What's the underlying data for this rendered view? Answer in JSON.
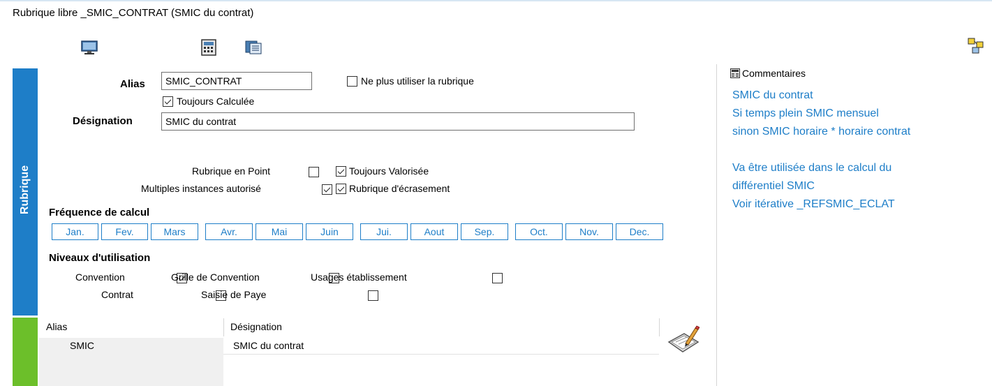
{
  "window": {
    "title": "Rubrique libre _SMIC_CONTRAT (SMIC du contrat)"
  },
  "toolbar": {
    "icons": [
      "monitor-icon",
      "calculator-icon",
      "window-list-icon",
      "flow-diagram-icon"
    ]
  },
  "sidebar": {
    "rubrique_label": "Rubrique"
  },
  "form": {
    "alias_label": "Alias",
    "alias_value": "SMIC_CONTRAT",
    "ne_plus_utiliser_label": "Ne plus utiliser la rubrique",
    "ne_plus_utiliser_checked": false,
    "toujours_calculee_label": "Toujours Calculée",
    "toujours_calculee_checked": true,
    "designation_label": "Désignation",
    "designation_value": "SMIC du contrat",
    "rubrique_en_point_label": "Rubrique en Point",
    "rubrique_en_point_checked": false,
    "toujours_valorisee_label": "Toujours Valorisée",
    "toujours_valorisee_checked": true,
    "multiples_instances_label": "Multiples instances autorisé",
    "multiples_instances_checked": true,
    "rubrique_ecrasement_label": "Rubrique d'écrasement",
    "rubrique_ecrasement_checked": true
  },
  "frequence": {
    "title": "Fréquence de calcul",
    "months": [
      "Jan.",
      "Fev.",
      "Mars",
      "Avr.",
      "Mai",
      "Juin",
      "Jui.",
      "Aout",
      "Sep.",
      "Oct.",
      "Nov.",
      "Dec."
    ]
  },
  "niveaux": {
    "title": "Niveaux d'utilisation",
    "convention_label": "Convention",
    "convention_checked": true,
    "grille_label": "Grille de Convention",
    "grille_checked": false,
    "usages_label": "Usages établissement",
    "usages_checked": false,
    "contrat_label": "Contrat",
    "contrat_checked": false,
    "saisie_label": "Saisie de Paye",
    "saisie_checked": false
  },
  "grid": {
    "columns": [
      "Alias",
      "Désignation"
    ],
    "rows": [
      {
        "alias": "SMIC",
        "designation": "SMIC du contrat"
      }
    ]
  },
  "comments": {
    "title": "Commentaires",
    "lines": [
      "SMIC du contrat",
      "Si temps plein SMIC mensuel",
      "sinon SMIC horaire * horaire contrat",
      "",
      "Va être utilisée dans le calcul du",
      "différentiel SMIC",
      "Voir itérative _REFSMIC_ECLAT"
    ]
  },
  "colors": {
    "accent_blue": "#1e7ec8",
    "accent_green": "#6cbf2a"
  }
}
